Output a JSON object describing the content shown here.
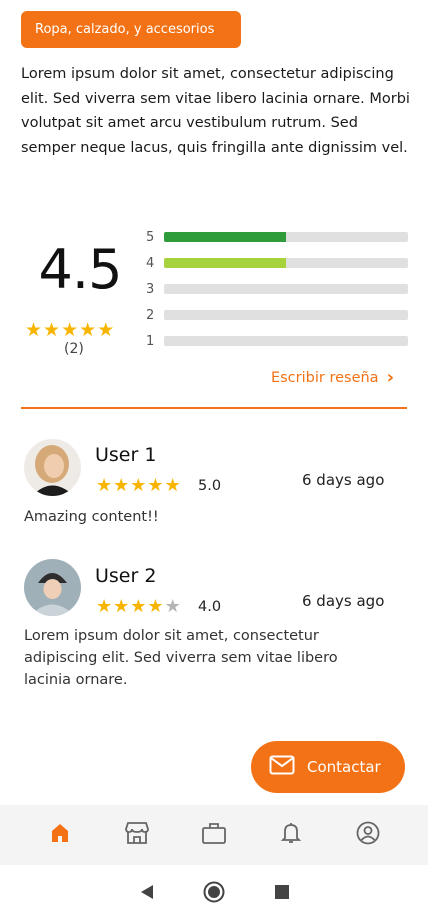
{
  "category": "Ropa, calzado, y accesorios",
  "description": "Lorem ipsum dolor sit amet, consectetur adipiscing elit. Sed viverra sem vitae libero lacinia ornare. Morbi volutpat sit amet arcu vestibulum rutrum. Sed semper neque lacus, quis fringilla ante dignissim vel.",
  "rating": {
    "average": "4.5",
    "average_stars": 4.5,
    "count_label": "(2)",
    "distribution": [
      {
        "label": "5",
        "fraction": 0.5,
        "color": "#2e9c3b"
      },
      {
        "label": "4",
        "fraction": 0.5,
        "color": "#a6d23c"
      },
      {
        "label": "3",
        "fraction": 0,
        "color": "#2e9c3b"
      },
      {
        "label": "2",
        "fraction": 0,
        "color": "#2e9c3b"
      },
      {
        "label": "1",
        "fraction": 0,
        "color": "#2e9c3b"
      }
    ]
  },
  "write_review_label": "Escribir reseña",
  "reviews": [
    {
      "user": "User 1",
      "stars": 5,
      "score": "5.0",
      "date": "6 days ago",
      "text": "Amazing content!!"
    },
    {
      "user": "User 2",
      "stars": 4,
      "score": "4.0",
      "date": "6 days ago",
      "text": "Lorem ipsum dolor sit amet, consectetur adipiscing elit. Sed viverra sem vitae libero lacinia ornare."
    }
  ],
  "contact_label": "Contactar",
  "nav": [
    {
      "name": "home-icon",
      "active": true
    },
    {
      "name": "store-icon",
      "active": false
    },
    {
      "name": "briefcase-icon",
      "active": false
    },
    {
      "name": "bell-icon",
      "active": false
    },
    {
      "name": "profile-icon",
      "active": false
    }
  ],
  "colors": {
    "accent": "#f47216",
    "star": "#f7b500",
    "star_empty": "#b5b5b5"
  }
}
